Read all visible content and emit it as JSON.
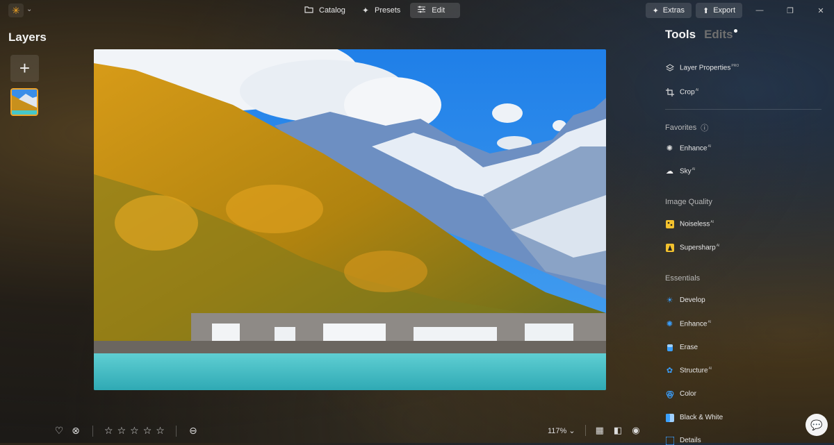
{
  "topbar": {
    "modes": [
      {
        "label": "Catalog",
        "icon": "folder-icon"
      },
      {
        "label": "Presets",
        "icon": "sparkle-icon"
      },
      {
        "label": "Edit",
        "icon": "sliders-icon",
        "active": true
      }
    ],
    "extras_label": "Extras",
    "export_label": "Export"
  },
  "layers": {
    "title": "Layers",
    "add_label": "+"
  },
  "right_panel": {
    "tab_tools": "Tools",
    "tab_edits": "Edits",
    "top_tools": [
      {
        "label": "Layer Properties",
        "badge": "PRO",
        "icon": "layers-icon"
      },
      {
        "label": "Crop",
        "badge": "AI",
        "icon": "crop-icon"
      }
    ],
    "favorites": {
      "title": "Favorites",
      "items": [
        {
          "label": "Enhance",
          "badge": "AI",
          "icon": "enhance-icon"
        },
        {
          "label": "Sky",
          "badge": "AI",
          "icon": "cloud-icon"
        }
      ]
    },
    "image_quality": {
      "title": "Image Quality",
      "items": [
        {
          "label": "Noiseless",
          "badge": "AI",
          "icon": "noiseless-icon"
        },
        {
          "label": "Supersharp",
          "badge": "AI",
          "icon": "supersharp-icon"
        }
      ]
    },
    "essentials": {
      "title": "Essentials",
      "items": [
        {
          "label": "Develop",
          "badge": "",
          "icon": "sun-icon"
        },
        {
          "label": "Enhance",
          "badge": "AI",
          "icon": "enhance-icon"
        },
        {
          "label": "Erase",
          "badge": "",
          "icon": "eraser-icon"
        },
        {
          "label": "Structure",
          "badge": "AI",
          "icon": "structure-icon"
        },
        {
          "label": "Color",
          "badge": "",
          "icon": "color-icon"
        },
        {
          "label": "Black & White",
          "badge": "",
          "icon": "bw-icon"
        },
        {
          "label": "Details",
          "badge": "",
          "icon": "details-icon"
        }
      ]
    }
  },
  "bottom": {
    "zoom": "117%",
    "rating": 0,
    "max_rating": 5
  },
  "colors": {
    "accent": "#f0a52a",
    "ai_blue": "#3aa0ff"
  }
}
